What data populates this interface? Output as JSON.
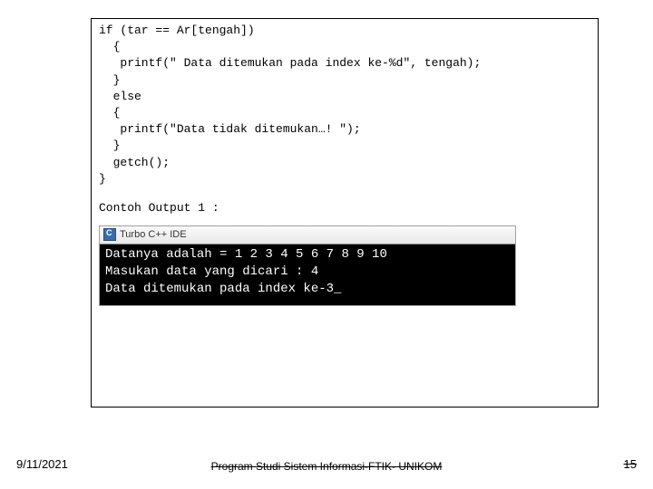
{
  "code": {
    "l1": "if (tar == Ar[tengah])",
    "l2": "  {",
    "l3": "   printf(\" Data ditemukan pada index ke-%d\", tengah);",
    "l4": "  }",
    "l5": "  else",
    "l6": "  {",
    "l7": "   printf(\"Data tidak ditemukan…! \");",
    "l8": "  }",
    "l9": "  getch();",
    "l10": "}"
  },
  "output_label": "Contoh Output 1 :",
  "terminal": {
    "title": "Turbo C++ IDE",
    "line1": "Datanya adalah = 1 2 3 4 5 6 7 8 9 10",
    "line2": "Masukan data yang dicari : 4",
    "line3": "Data ditemukan pada index ke-3_"
  },
  "footer": {
    "date": "9/11/2021",
    "center": "Program Studi Sistem Informasi-FTIK-\nUNIKOM",
    "page": "15"
  }
}
